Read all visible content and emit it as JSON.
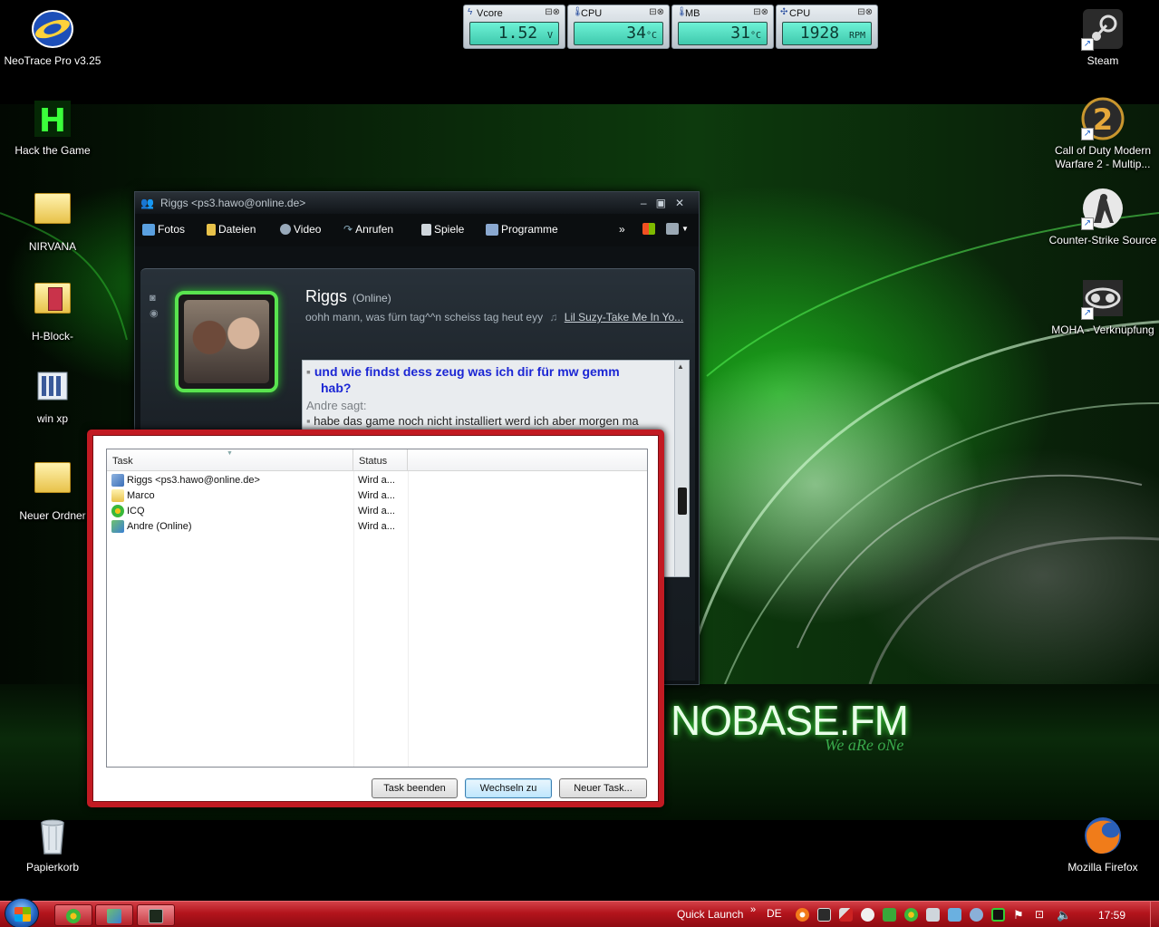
{
  "desktop": {
    "icons_left": [
      {
        "label": "NeoTrace Pro v3.25",
        "icon": "neotrace-icon"
      },
      {
        "label": "Hack the Game",
        "icon": "hack-the-game-icon"
      },
      {
        "label": "NIRVANA",
        "icon": "folder-icon"
      },
      {
        "label": "H-Block-",
        "icon": "folder-icon"
      },
      {
        "label": "win xp",
        "icon": "computer-icon"
      },
      {
        "label": "Neuer Ordner",
        "icon": "folder-icon"
      },
      {
        "label": "Papierkorb",
        "icon": "recycle-bin-icon"
      }
    ],
    "icons_right": [
      {
        "label": "Steam",
        "icon": "steam-icon"
      },
      {
        "label": "Call of Duty Modern Warfare 2 - Multip...",
        "icon": "cod-mw2-icon"
      },
      {
        "label": "Counter-Strike Source",
        "icon": "counter-strike-icon"
      },
      {
        "label": "MOHA - Verknüpfung",
        "icon": "moha-icon"
      },
      {
        "label": "Mozilla Firefox",
        "icon": "firefox-icon"
      }
    ],
    "wallpaper_brand": "NOBASE.FM",
    "wallpaper_tagline": "We aRe oNe"
  },
  "gadgets": [
    {
      "label": "Vcore",
      "value": "1.52",
      "unit": "V"
    },
    {
      "label": "CPU",
      "value": "34",
      "unit": "°C"
    },
    {
      "label": "MB",
      "value": "31",
      "unit": "°C"
    },
    {
      "label": "CPU",
      "value": "1928",
      "unit": "RPM"
    }
  ],
  "messenger": {
    "title": "Riggs <ps3.hawo@online.de>",
    "toolbar": [
      "Fotos",
      "Dateien",
      "Video",
      "Anrufen",
      "Spiele",
      "Programme"
    ],
    "more": "»",
    "contact_name": "Riggs",
    "contact_status": "(Online)",
    "personal_message": "oohh mann, was fürn tag^^n scheiss tag heut eyy",
    "now_playing": "Lil Suzy-Take Me In Yo...",
    "chat": {
      "line1": "und wie findst dess zeug was ich dir für mw gemm",
      "line2": "hab?",
      "sender": "Andre sagt:",
      "line3": "habe das game noch nicht installiert werd ich aber morgen ma"
    }
  },
  "taskmanager": {
    "columns": [
      "Task",
      "Status"
    ],
    "rows": [
      {
        "task": "Riggs <ps3.hawo@online.de>",
        "status": "Wird a...",
        "icon": "messenger-icon"
      },
      {
        "task": "Marco",
        "status": "Wird a...",
        "icon": "folder-icon"
      },
      {
        "task": "ICQ",
        "status": "Wird a...",
        "icon": "icq-icon"
      },
      {
        "task": "Andre (Online)",
        "status": "Wird a...",
        "icon": "contacts-icon"
      }
    ],
    "buttons": {
      "end": "Task beenden",
      "switch": "Wechseln zu",
      "new": "Neuer Task..."
    }
  },
  "taskbar": {
    "quick_launch": "Quick Launch",
    "chevron": "»",
    "language": "DE",
    "clock": "17:59"
  },
  "colors": {
    "taskbar": "#b3141c",
    "taskmgr_frame": "#c21a22",
    "gadget_screen": "#4fd9bd",
    "avatar_frame": "#59e34f"
  }
}
